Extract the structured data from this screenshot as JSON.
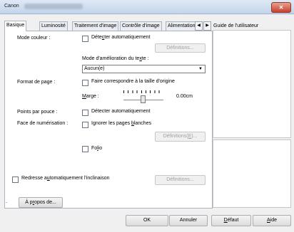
{
  "window": {
    "title": "Canon",
    "close_glyph": "✕"
  },
  "tabs": [
    "Basique",
    "Luminosité",
    "Traitement d'image",
    "Contrôle d'image",
    "Alimentation"
  ],
  "tab_scroll": {
    "left": "◀",
    "right": "▶"
  },
  "guide": {
    "label": "Guide de l'utilisateur"
  },
  "mode_couleur": {
    "label": "Mode couleur :",
    "detect_label_pre": "Déte",
    "detect_label_u": "c",
    "detect_label_post": "ter automatiquement",
    "definitions_label": "Définitions..."
  },
  "amelioration": {
    "label_pre": "Mode d'amélioration du te",
    "label_u": "x",
    "label_post": "te :",
    "selected": "Aucun(e)",
    "arrow": "▼"
  },
  "format_page": {
    "label": "Format de page :",
    "match_label": "Faire correspondre à la taille d'origine",
    "marge_u": "M",
    "marge_rest": "arge :",
    "marge_value": "0.00cm",
    "marge_level": 0.5
  },
  "points": {
    "label": "Points par pouce :",
    "detect_label": "Détecter automatiquement"
  },
  "face": {
    "label": "Face de numérisation :",
    "ignore_pre": "Ignorer les pages ",
    "ignore_u": "b",
    "ignore_post": "lanches",
    "definitions_pre": "Définitions(",
    "definitions_u": "E",
    "definitions_post": ")...",
    "folio_label": "Fo",
    "folio_u": "l",
    "folio_post": "io"
  },
  "redresse": {
    "label_pre": "Redresse a",
    "label_u": "u",
    "label_post": "tomatiquement l'inclinaison",
    "definitions_label": "Définitions..."
  },
  "apropos": {
    "dash": "-",
    "label_u": "À p",
    "label_mid": "r",
    "label_post": "opos de..."
  },
  "footer": {
    "ok": "OK",
    "annuler": "Annuler",
    "defaut_u": "D",
    "defaut_rest": "éfaut",
    "aide_u": "A",
    "aide_rest": "ide"
  }
}
